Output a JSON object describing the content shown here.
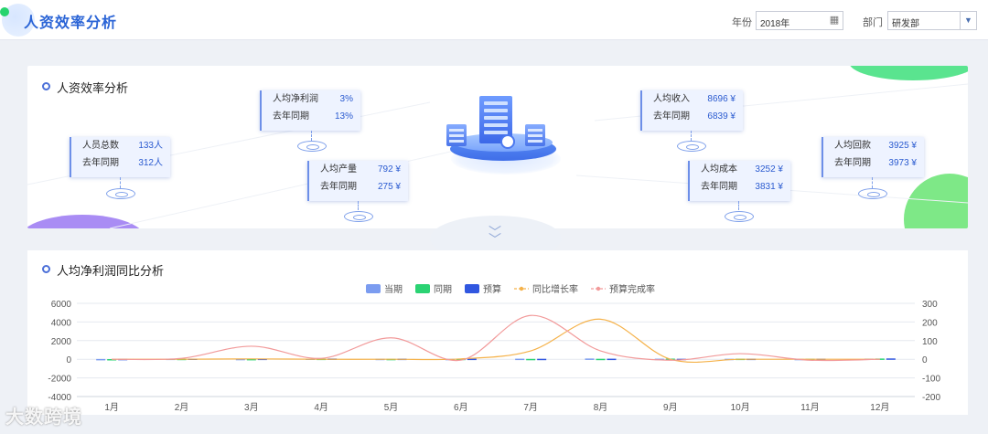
{
  "header": {
    "title": "人资效率分析",
    "year_label": "年份",
    "year_value": "2018年",
    "dept_label": "部门",
    "dept_value": "研发部"
  },
  "panel_efficiency": {
    "title": "人资效率分析",
    "cards": [
      {
        "id": "headcount",
        "label": "人员总数",
        "value": "133人",
        "last_label": "去年同期",
        "last_value": "312人"
      },
      {
        "id": "net-profit",
        "label": "人均净利润",
        "value": "3%",
        "last_label": "去年同期",
        "last_value": "13%"
      },
      {
        "id": "output",
        "label": "人均产量",
        "value": "792 ¥",
        "last_label": "去年同期",
        "last_value": "275 ¥"
      },
      {
        "id": "income",
        "label": "人均收入",
        "value": "8696 ¥",
        "last_label": "去年同期",
        "last_value": "6839 ¥"
      },
      {
        "id": "cost",
        "label": "人均成本",
        "value": "3252 ¥",
        "last_label": "去年同期",
        "last_value": "3831 ¥"
      },
      {
        "id": "payback",
        "label": "人均回款",
        "value": "3925 ¥",
        "last_label": "去年同期",
        "last_value": "3973 ¥"
      }
    ]
  },
  "panel_profit": {
    "title": "人均净利润同比分析"
  },
  "colors": {
    "current": "#7b9cf0",
    "same_period": "#2bd373",
    "budget": "#3157e0",
    "yoy": "#f5b24a",
    "budget_rate": "#f29a9a"
  },
  "chart_data": {
    "type": "bar",
    "categories": [
      "1月",
      "2月",
      "3月",
      "4月",
      "5月",
      "6月",
      "7月",
      "8月",
      "9月",
      "10月",
      "11月",
      "12月"
    ],
    "series": [
      {
        "name": "当期",
        "kind": "bar",
        "axis": "left",
        "values": [
          30,
          60,
          40,
          70,
          50,
          40,
          60,
          80,
          60,
          50,
          40,
          70
        ]
      },
      {
        "name": "同期",
        "kind": "bar",
        "axis": "left",
        "values": [
          20,
          50,
          30,
          60,
          40,
          50,
          40,
          50,
          70,
          60,
          50,
          80
        ]
      },
      {
        "name": "预算",
        "kind": "bar",
        "axis": "left",
        "values": [
          40,
          70,
          60,
          80,
          60,
          60,
          50,
          60,
          50,
          60,
          60,
          90
        ]
      },
      {
        "name": "同比增长率",
        "kind": "line",
        "axis": "right",
        "values": [
          0,
          0,
          2,
          0,
          0,
          2,
          45,
          215,
          0,
          0,
          0,
          0
        ]
      },
      {
        "name": "预算完成率",
        "kind": "line",
        "axis": "right",
        "values": [
          0,
          5,
          70,
          5,
          115,
          -5,
          235,
          45,
          -5,
          30,
          -5,
          0
        ]
      }
    ],
    "ylim": [
      -4000,
      6000
    ],
    "yticks": [
      "6000",
      "4000",
      "2000",
      "0",
      "-2000",
      "-4000"
    ],
    "y2lim": [
      -200,
      300
    ],
    "y2ticks": [
      "300",
      "200",
      "100",
      "0",
      "-100",
      "-200"
    ],
    "legend": "top-center",
    "grid": true
  },
  "watermark": "大数跨境"
}
